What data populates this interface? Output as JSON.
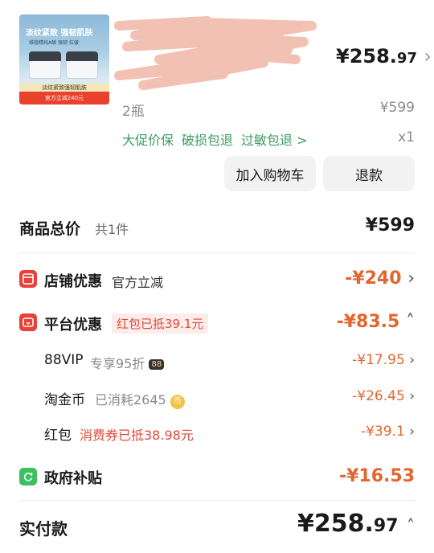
{
  "product": {
    "image_title": "淡纹紧致 强韧肌肤",
    "image_subtitle": "维稳精纯A醇 强韧 抗皱",
    "image_band": "淡纹紧致强韧肌肤",
    "image_promo": "官方立减240元",
    "price_main": "¥258.",
    "price_decimal": "97",
    "variant": "2瓶",
    "original_price": "¥599",
    "services": [
      "大促价保",
      "破损包退",
      "过敏包退 >"
    ],
    "quantity": "x1"
  },
  "actions": {
    "add_to_cart": "加入购物车",
    "refund": "退款"
  },
  "summary": {
    "total_label": "商品总价",
    "total_count": "共1件",
    "total_value": "¥599"
  },
  "discounts": {
    "shop": {
      "label": "店铺优惠",
      "desc": "官方立减",
      "value": "-¥240"
    },
    "platform": {
      "label": "平台优惠",
      "tag": "红包已抵39.1元",
      "value": "-¥83.5"
    },
    "vip": {
      "label": "88VIP",
      "desc": "专享95折",
      "badge": "88",
      "value": "-¥17.95"
    },
    "taojinbi": {
      "label": "淘金币",
      "desc": "已消耗2645",
      "coin": "币",
      "value": "-¥26.45"
    },
    "hongbao": {
      "label": "红包",
      "desc": "消费券已抵38.98元",
      "value": "-¥39.1"
    },
    "government": {
      "label": "政府补贴",
      "value": "-¥16.53"
    }
  },
  "payment": {
    "label": "实付款",
    "value_main": "¥258.",
    "value_decimal": "97"
  },
  "colors": {
    "discount_orange": "#e2672e",
    "service_green": "#3f9b62",
    "red_icon": "#e8423a",
    "green_icon": "#3cc060"
  }
}
